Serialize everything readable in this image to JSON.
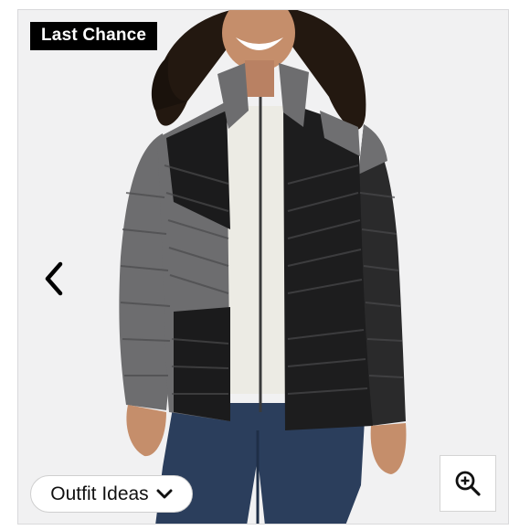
{
  "product_gallery": {
    "badge": "Last Chance",
    "outfit_button_label": "Outfit Ideas",
    "icons": {
      "prev": "chevron-left-icon",
      "dropdown": "chevron-down-icon",
      "zoom": "zoom-in-icon"
    },
    "colors": {
      "badge_bg": "#000000",
      "badge_text": "#ffffff",
      "photo_bg": "#f1f1f2",
      "jacket_light": "#6d6d6f",
      "jacket_dark": "#1b1b1c",
      "jeans": "#2b3e5c",
      "shirt": "#ecebe4"
    }
  }
}
